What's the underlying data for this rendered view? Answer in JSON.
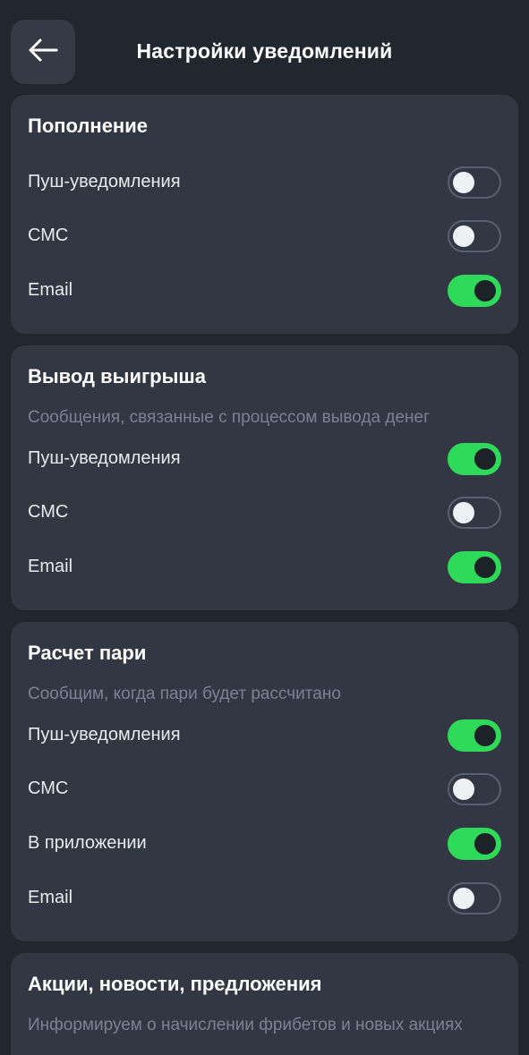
{
  "header": {
    "title": "Настройки уведомлений",
    "back_icon": "arrow-left-icon"
  },
  "colors": {
    "background": "#22262e",
    "card": "#323743",
    "toggle_on": "#2fd95a",
    "toggle_off_border": "#5a6070",
    "description": "#7c8291"
  },
  "sections": [
    {
      "title": "Пополнение",
      "rows": [
        {
          "label": "Пуш-уведомления",
          "enabled": false
        },
        {
          "label": "СМС",
          "enabled": false
        },
        {
          "label": "Email",
          "enabled": true
        }
      ]
    },
    {
      "title": "Вывод выигрыша",
      "description": "Сообщения, связанные с процессом вывода денег",
      "rows": [
        {
          "label": "Пуш-уведомления",
          "enabled": true
        },
        {
          "label": "СМС",
          "enabled": false
        },
        {
          "label": "Email",
          "enabled": true
        }
      ]
    },
    {
      "title": "Расчет пари",
      "description": "Сообщим, когда пари будет рассчитано",
      "rows": [
        {
          "label": "Пуш-уведомления",
          "enabled": true
        },
        {
          "label": "СМС",
          "enabled": false
        },
        {
          "label": "В приложении",
          "enabled": true
        },
        {
          "label": "Email",
          "enabled": false
        }
      ]
    },
    {
      "title": "Акции, новости, предложения",
      "description": "Информируем о начислении фрибетов и новых акциях"
    }
  ]
}
